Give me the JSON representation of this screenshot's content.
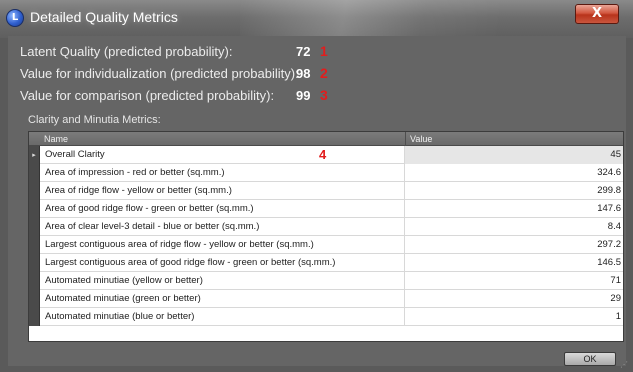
{
  "window": {
    "title": "Detailed Quality Metrics",
    "close_label": "X",
    "app_icon_glyph": "L"
  },
  "metrics": [
    {
      "label": "Latent Quality (predicted probability):",
      "value": "72",
      "marker": "1"
    },
    {
      "label": "Value for individualization (predicted probability):",
      "value": "98",
      "marker": "2"
    },
    {
      "label": "Value for comparison (predicted probability):",
      "value": "99",
      "marker": "3"
    }
  ],
  "section_label": "Clarity and Minutia Metrics:",
  "grid": {
    "columns": [
      "Name",
      "Value"
    ],
    "selected_row_marker": "▸",
    "row_annotation": "4",
    "rows": [
      {
        "name": "Overall Clarity",
        "value": "45"
      },
      {
        "name": "Area of impression - red or better  (sq.mm.)",
        "value": "324.6"
      },
      {
        "name": "Area of ridge flow - yellow or better  (sq.mm.)",
        "value": "299.8"
      },
      {
        "name": "Area of good ridge flow - green or better  (sq.mm.)",
        "value": "147.6"
      },
      {
        "name": "Area of clear level-3 detail - blue or better  (sq.mm.)",
        "value": "8.4"
      },
      {
        "name": "Largest contiguous area of ridge flow - yellow or better  (sq.mm.)",
        "value": "297.2"
      },
      {
        "name": "Largest contiguous area of good ridge flow - green or better  (sq.mm.)",
        "value": "146.5"
      },
      {
        "name": "Automated minutiae (yellow or better)",
        "value": "71"
      },
      {
        "name": "Automated minutiae (green or better)",
        "value": "29"
      },
      {
        "name": "Automated minutiae (blue or better)",
        "value": "1"
      }
    ]
  },
  "buttons": {
    "ok_label": "OK"
  },
  "colors": {
    "annotation": "#e21d1d",
    "close_button": "#c9563e"
  },
  "icons": {
    "close": "close-icon",
    "app": "app-icon",
    "resize": "resize-grip-icon"
  }
}
